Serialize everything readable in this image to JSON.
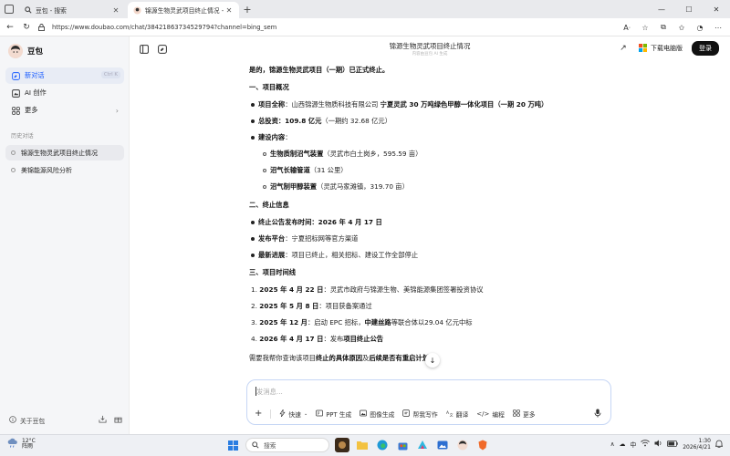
{
  "browser": {
    "tabs": [
      {
        "title": "豆包 - 搜索",
        "active": false
      },
      {
        "title": "锦源生物灵武项目终止情况 - 豆包",
        "active": true
      }
    ],
    "url": "https://www.doubao.com/chat/38421863734529794?channel=bing_sem"
  },
  "sidebar": {
    "brand": "豆包",
    "menu": [
      {
        "label": "新对话",
        "shortcut": "Ctrl K",
        "active": true,
        "icon": "new-chat-icon"
      },
      {
        "label": "AI 创作",
        "icon": "ai-create-icon"
      },
      {
        "label": "更多",
        "icon": "more-grid-icon"
      }
    ],
    "history_label": "历史对话",
    "history": [
      {
        "label": "锦源生物灵武项目终止情况",
        "active": true
      },
      {
        "label": "美锦能源风险分析",
        "active": false
      }
    ],
    "about": "关于豆包"
  },
  "header": {
    "title": "锦源生物灵武项目终止情况",
    "subtitle": "内容由豆包 AI 生成",
    "download": "下载电脑版",
    "login": "登录"
  },
  "answer": {
    "lead": "是的，锦源生物灵武项目（一期）已正式终止。",
    "sec1": "一、项目概况",
    "fullname_label": "项目全称",
    "fullname_company": "：山西锦源生物质科技有限公司 ",
    "fullname_project": "宁夏灵武 30 万吨绿色甲醇一体化项目（一期 20 万吨）",
    "invest_label": "总投资",
    "invest_value": "：109.8 亿元",
    "invest_note": "（一期约 32.68 亿元）",
    "build_label": "建设内容",
    "build_colon": "：",
    "build_items": [
      {
        "name": "生物质制沼气装置",
        "detail": "（灵武市白土岗乡，595.59 亩）"
      },
      {
        "name": "沼气长输管道",
        "detail": "（31 公里）"
      },
      {
        "name": "沼气制甲醇装置",
        "detail": "（灵武马家滩镇，319.70 亩）"
      }
    ],
    "sec2": "二、终止信息",
    "announce_label": "终止公告发布时间",
    "announce_value": "：2026 年 4 月 17 日",
    "platform_label": "发布平台",
    "platform_value": "：宁夏招标网等官方渠道",
    "progress_label": "最新进展",
    "progress_value": "：项目已终止，相关招标、建设工作全部停止",
    "sec3": "三、项目时间线",
    "timeline": [
      {
        "n": "1.",
        "date": "2025 年 4 月 22 日",
        "pre": "：灵武市政府与锦源生物、美锦能源集团签署投资协议",
        "bold": "",
        "post": ""
      },
      {
        "n": "2.",
        "date": "2025 年 5 月 8 日",
        "pre": "：项目获备案通过",
        "bold": "",
        "post": ""
      },
      {
        "n": "3.",
        "date": "2025 年 12 月",
        "pre": "：启动 EPC 招标，",
        "bold": "中建丝路",
        "post": "等联合体以29.04 亿元中标"
      },
      {
        "n": "4.",
        "date": "2026 年 4 月 17 日",
        "pre": "：发布",
        "bold": "项目终止公告",
        "post": ""
      }
    ],
    "followup_pre": "需要我帮你查询该项目",
    "followup_b1": "终止的具体原因",
    "followup_mid": "及",
    "followup_b2": "后续是否有重启计划",
    "followup_post": "吗?"
  },
  "input": {
    "placeholder": "发消息...",
    "tools": [
      "快速",
      "PPT 生成",
      "图像生成",
      "帮我写作",
      "翻译",
      "编程",
      "更多"
    ]
  },
  "taskbar": {
    "temp": "12°C",
    "weather": "阵雨",
    "search": "搜索",
    "ime": "中",
    "time": "1:30",
    "date": "2026/4/21"
  }
}
